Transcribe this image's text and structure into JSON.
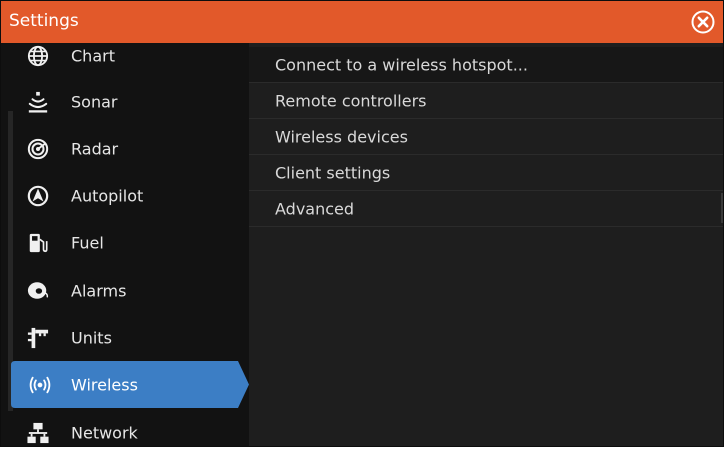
{
  "window": {
    "title": "Settings",
    "accent_color": "#e2592a",
    "selected_color": "#3c7ec5"
  },
  "sidebar": {
    "items": [
      {
        "label": "Chart",
        "icon": "globe-icon"
      },
      {
        "label": "Sonar",
        "icon": "sonar-icon"
      },
      {
        "label": "Radar",
        "icon": "radar-icon"
      },
      {
        "label": "Autopilot",
        "icon": "autopilot-icon"
      },
      {
        "label": "Fuel",
        "icon": "fuel-pump-icon"
      },
      {
        "label": "Alarms",
        "icon": "alarm-bell-icon"
      },
      {
        "label": "Units",
        "icon": "ruler-icon"
      },
      {
        "label": "Wireless",
        "icon": "wireless-icon",
        "selected": true
      },
      {
        "label": "Network",
        "icon": "network-icon"
      }
    ]
  },
  "main": {
    "options": [
      {
        "label": "Connect to a wireless hotspot..."
      },
      {
        "label": "Remote controllers"
      },
      {
        "label": "Wireless devices"
      },
      {
        "label": "Client settings"
      },
      {
        "label": "Advanced"
      }
    ]
  }
}
